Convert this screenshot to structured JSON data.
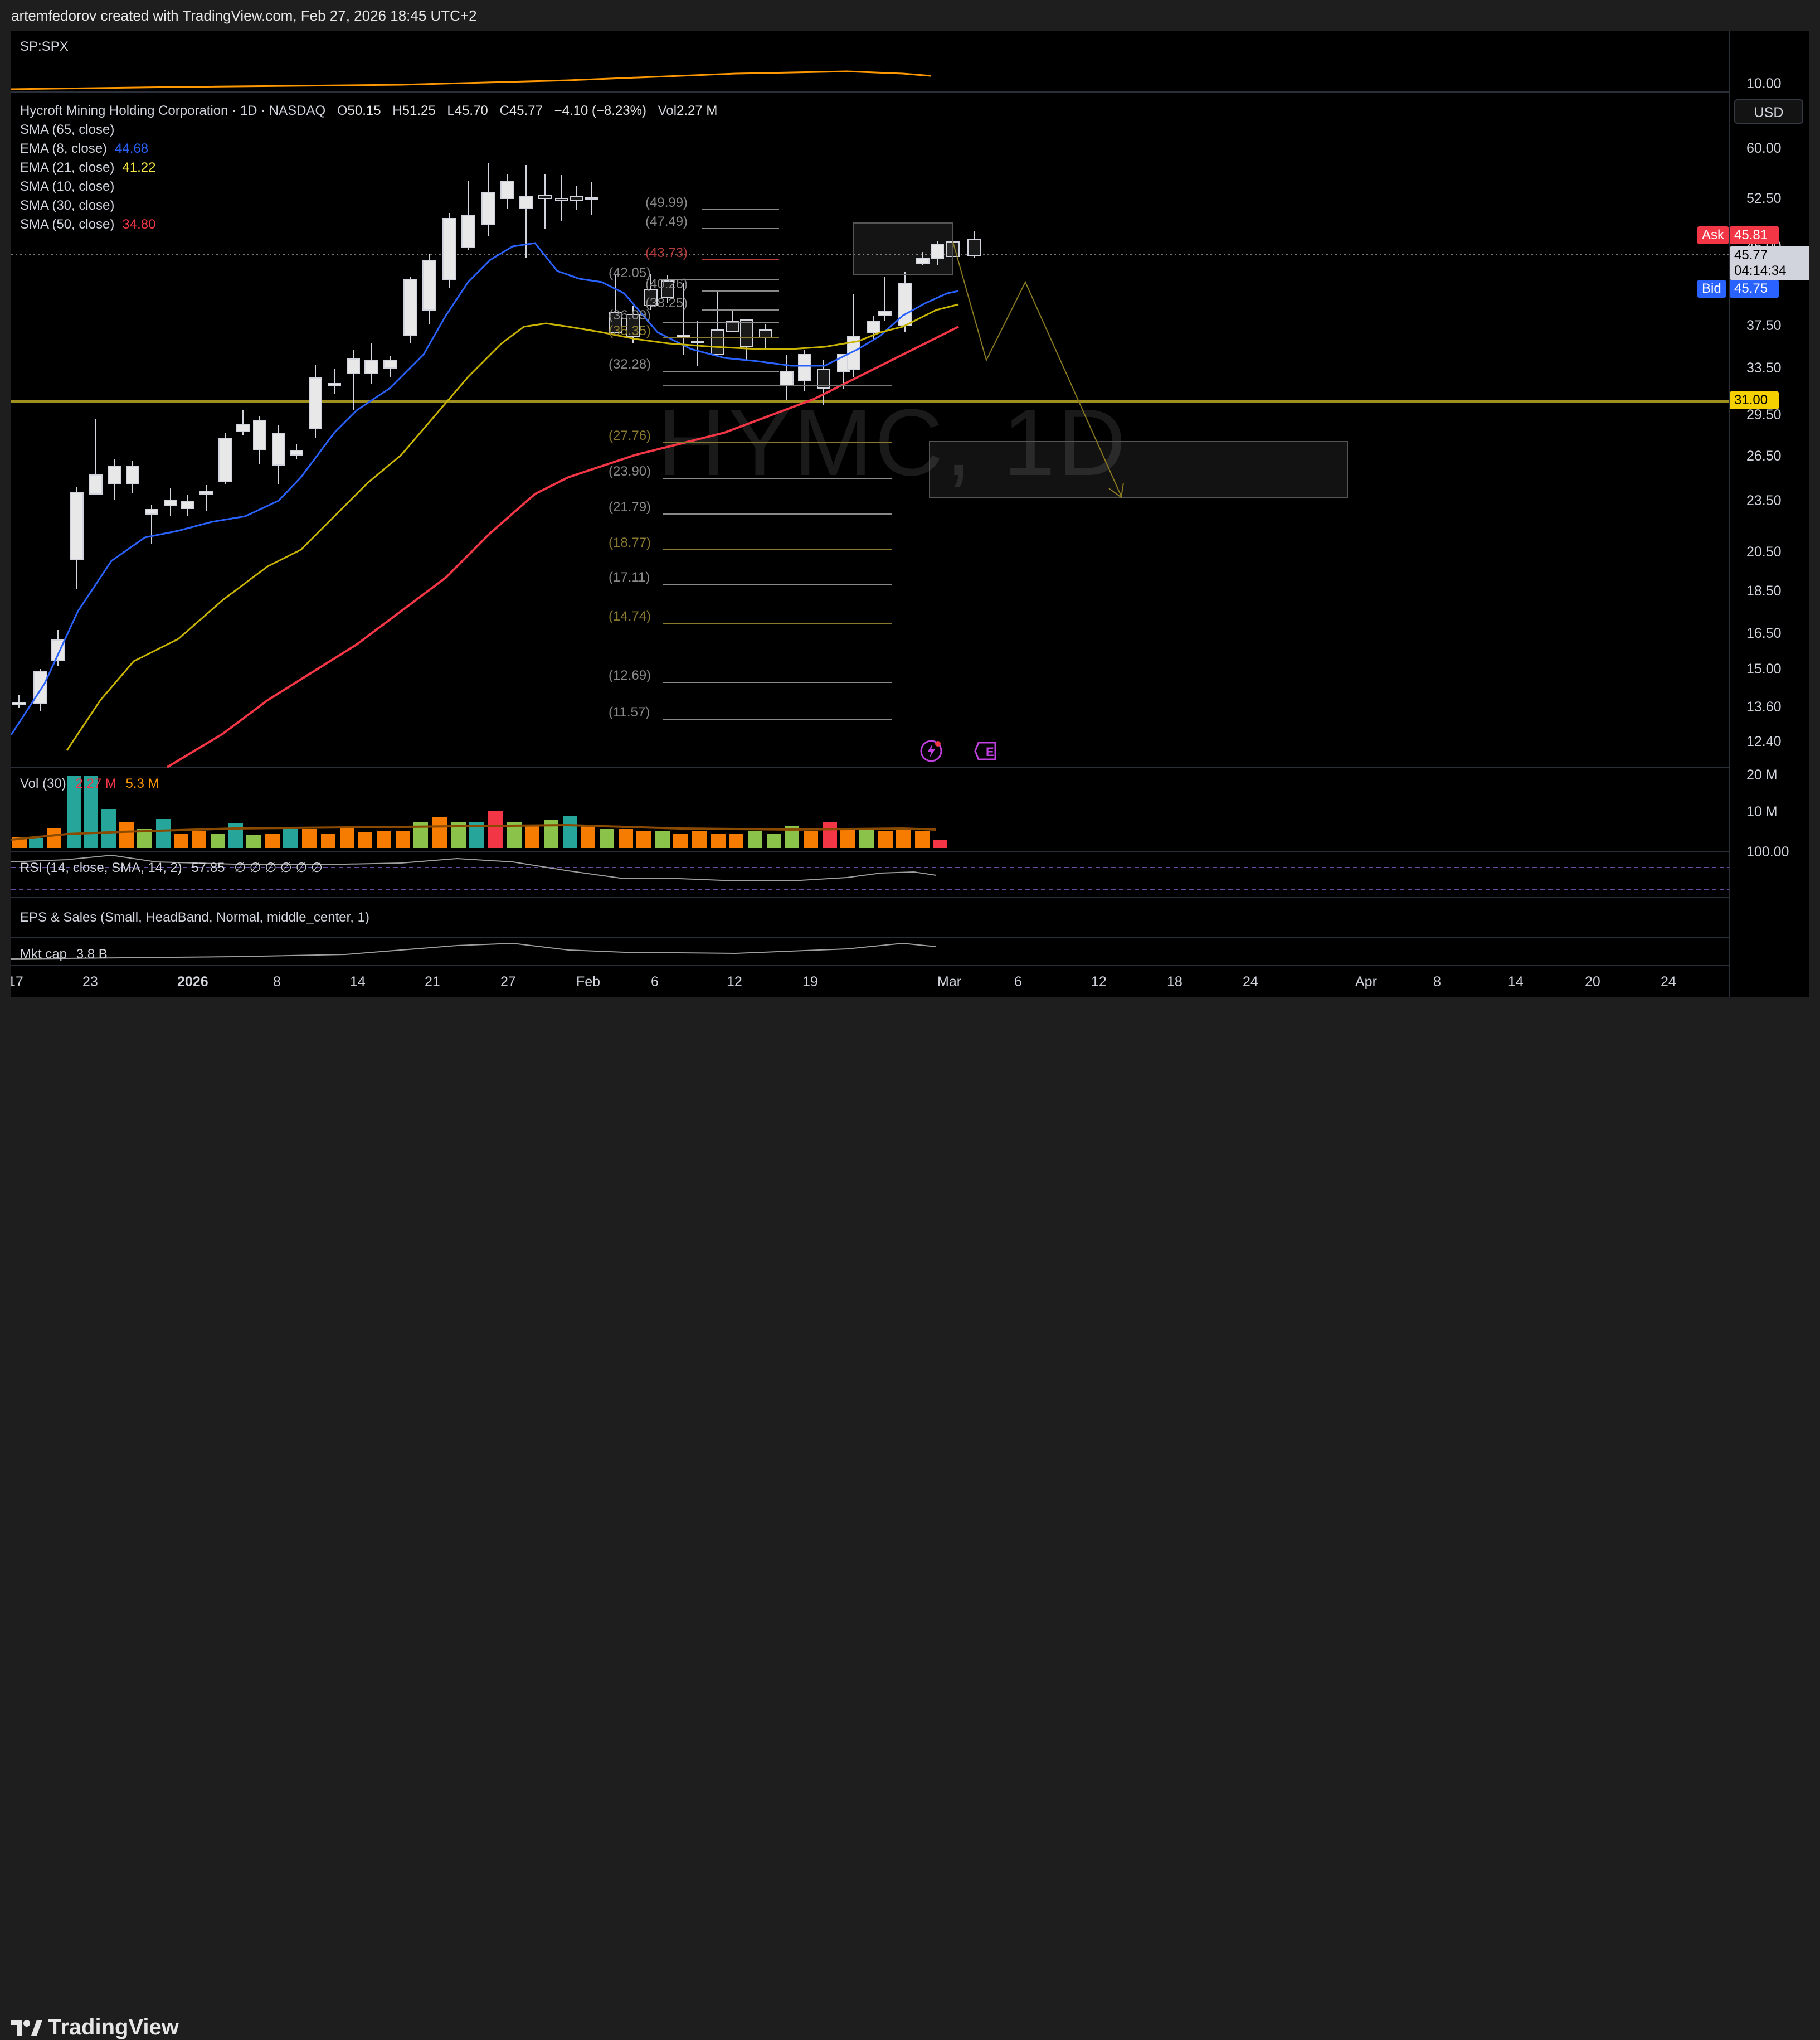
{
  "header": {
    "attribution": "artemfedorov created with TradingView.com, Feb 27, 2026 18:45 UTC+2"
  },
  "compare_pane": {
    "symbol": "SP:SPX",
    "axis_label": "10.00"
  },
  "main_pane": {
    "symbol_line": {
      "name": "Hycroft Mining Holding Corporation · 1D · NASDAQ",
      "o_label": "O",
      "o": "50.15",
      "h_label": "H",
      "h": "51.25",
      "l_label": "L",
      "l": "45.70",
      "c_label": "C",
      "c": "45.77",
      "change": "−4.10 (−8.23%)",
      "vol_label": "Vol",
      "vol": "2.27 M"
    },
    "indicators": [
      {
        "label": "SMA (65, close)",
        "value": "",
        "color": "#d1d4dc"
      },
      {
        "label": "EMA (8, close)",
        "value": "44.68",
        "color": "#2962ff"
      },
      {
        "label": "EMA (21, close)",
        "value": "41.22",
        "color": "#f5e642"
      },
      {
        "label": "SMA (10, close)",
        "value": "",
        "color": "#d1d4dc"
      },
      {
        "label": "SMA (30, close)",
        "value": "",
        "color": "#d1d4dc"
      },
      {
        "label": "SMA (50, close)",
        "value": "34.80",
        "color": "#f23645"
      }
    ],
    "watermark": "HYMC, 1D",
    "currency": "USD",
    "price_axis": [
      "60.00",
      "52.50",
      "45.00",
      "37.50",
      "33.50",
      "29.50",
      "26.50",
      "23.50",
      "20.50",
      "18.50",
      "16.50",
      "15.00",
      "13.60",
      "12.40"
    ],
    "ask": {
      "label": "Ask",
      "value": "45.81",
      "color": "#f23645"
    },
    "last": {
      "value": "45.77",
      "countdown": "04:14:34"
    },
    "bid": {
      "label": "Bid",
      "value": "45.75",
      "color": "#2962ff"
    },
    "level_tag": {
      "value": "31.00",
      "color": "#f5d000"
    },
    "fib_levels": [
      {
        "label": "(49.99)",
        "color": "#8a8a8a"
      },
      {
        "label": "(47.49)",
        "color": "#8a8a8a"
      },
      {
        "label": "(43.73)",
        "color": "#b23b3b"
      },
      {
        "label": "(42.05)",
        "color": "#8a8a8a"
      },
      {
        "label": "(40.26)",
        "color": "#8a8a8a"
      },
      {
        "label": "(38.25)",
        "color": "#8a8a8a"
      },
      {
        "label": "(36.09)",
        "color": "#8a8a8a"
      },
      {
        "label": "(35.35)",
        "color": "#8a7a30"
      },
      {
        "label": "(32.28)",
        "color": "#8a8a8a"
      },
      {
        "label": "(27.76)",
        "color": "#8a7a30"
      },
      {
        "label": "(23.90)",
        "color": "#8a8a8a"
      },
      {
        "label": "(21.79)",
        "color": "#8a8a8a"
      },
      {
        "label": "(18.77)",
        "color": "#8a7a30"
      },
      {
        "label": "(17.11)",
        "color": "#8a8a8a"
      },
      {
        "label": "(14.74)",
        "color": "#8a7a30"
      },
      {
        "label": "(12.69)",
        "color": "#8a8a8a"
      },
      {
        "label": "(11.57)",
        "color": "#8a8a8a"
      }
    ]
  },
  "volume_pane": {
    "label": "Vol (30)",
    "v1": "2.27 M",
    "v2": "5.3 M",
    "axis": [
      "20 M",
      "10 M"
    ]
  },
  "rsi_pane": {
    "label": "RSI (14, close, SMA, 14, 2)",
    "value": "57.85",
    "na": "∅ ∅ ∅ ∅ ∅ ∅",
    "axis": "100.00"
  },
  "eps_pane": {
    "label": "EPS & Sales (Small, HeadBand, Normal, middle_center, 1)"
  },
  "mktcap_pane": {
    "label": "Mkt cap",
    "value": "3.8 B"
  },
  "time_axis": [
    "17",
    "23",
    "2026",
    "8",
    "14",
    "21",
    "27",
    "Feb",
    "6",
    "12",
    "19",
    "Mar",
    "6",
    "12",
    "18",
    "24",
    "Apr",
    "8",
    "14",
    "20",
    "24"
  ],
  "footer": {
    "brand": "TradingView"
  },
  "chart_data": {
    "type": "candlestick",
    "symbol": "HYMC",
    "interval": "1D",
    "last_bar": {
      "open": 50.15,
      "high": 51.25,
      "low": 45.7,
      "close": 45.77
    },
    "ema8": 44.68,
    "ema21": 41.22,
    "sma50": 34.8,
    "horizontal_level": 31.0,
    "ylim": [
      11.57,
      62
    ]
  }
}
